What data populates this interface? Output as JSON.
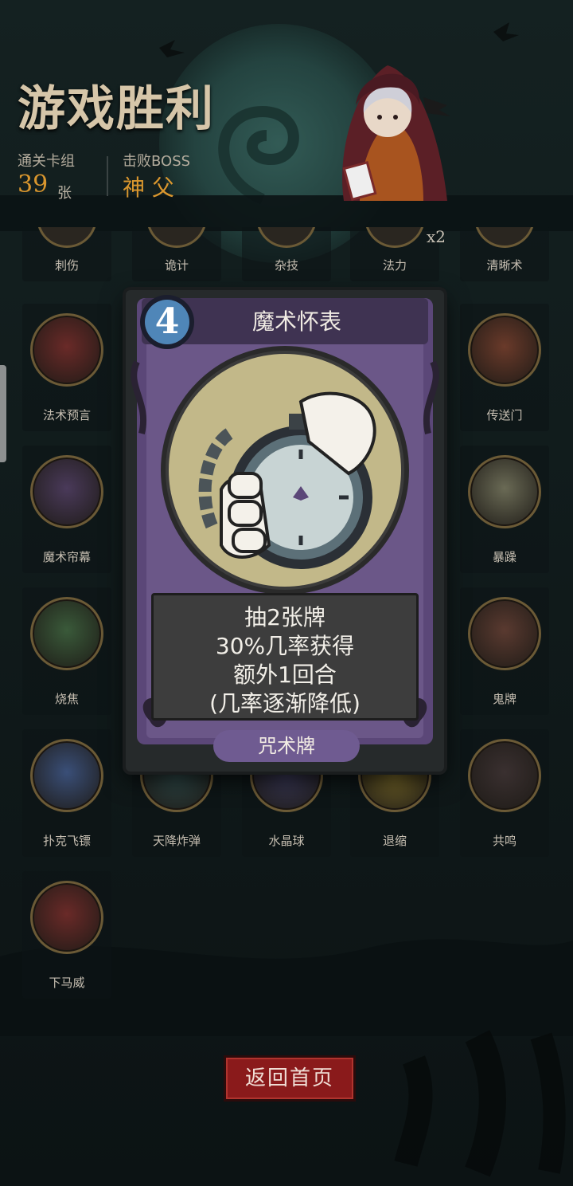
{
  "header": {
    "title": "游戏胜利",
    "deck_label": "通关卡组",
    "deck_count": "39",
    "deck_unit": "张",
    "boss_label": "击败BOSS",
    "boss_name": "神 父"
  },
  "cards": [
    {
      "name": "刺伤",
      "icon": "stab-icon",
      "partial": true
    },
    {
      "name": "诡计",
      "icon": "trick-icon",
      "partial": true
    },
    {
      "name": "杂技",
      "icon": "acrobat-icon",
      "partial": true
    },
    {
      "name": "法力",
      "icon": "mana-icon",
      "partial": true,
      "badge": "x2"
    },
    {
      "name": "清晰术",
      "icon": "clarity-icon",
      "partial": true
    },
    {
      "name": "法术预言",
      "icon": "prophecy-icon"
    },
    {
      "name": "传送门",
      "icon": "portal-icon"
    },
    {
      "name": "魔术帘幕",
      "icon": "curtain-icon"
    },
    {
      "name": "暴躁",
      "icon": "rage-icon"
    },
    {
      "name": "烧焦",
      "icon": "fire-icon"
    },
    {
      "name": "鬼牌",
      "icon": "joker-icon"
    },
    {
      "name": "扑克飞镖",
      "icon": "card-dart-icon"
    },
    {
      "name": "天降炸弹",
      "icon": "bomb-icon"
    },
    {
      "name": "水晶球",
      "icon": "crystal-ball-icon"
    },
    {
      "name": "退缩",
      "icon": "retreat-icon"
    },
    {
      "name": "共鸣",
      "icon": "resonance-icon"
    },
    {
      "name": "下马威",
      "icon": "lightning-icon"
    }
  ],
  "popup_card": {
    "cost": "4",
    "name": "魔术怀表",
    "desc_line1": "抽2张牌",
    "desc_line2": "30%几率获得",
    "desc_line3": "额外1回合",
    "desc_line4": "(几率逐渐降低)",
    "type": "咒术牌",
    "art_icon": "pocket-watch-icon"
  },
  "footer": {
    "back_label": "返回首页"
  },
  "colors": {
    "accent_gold": "#d9962e",
    "card_purple": "#5b4778",
    "button_red": "#8a1a1b"
  }
}
